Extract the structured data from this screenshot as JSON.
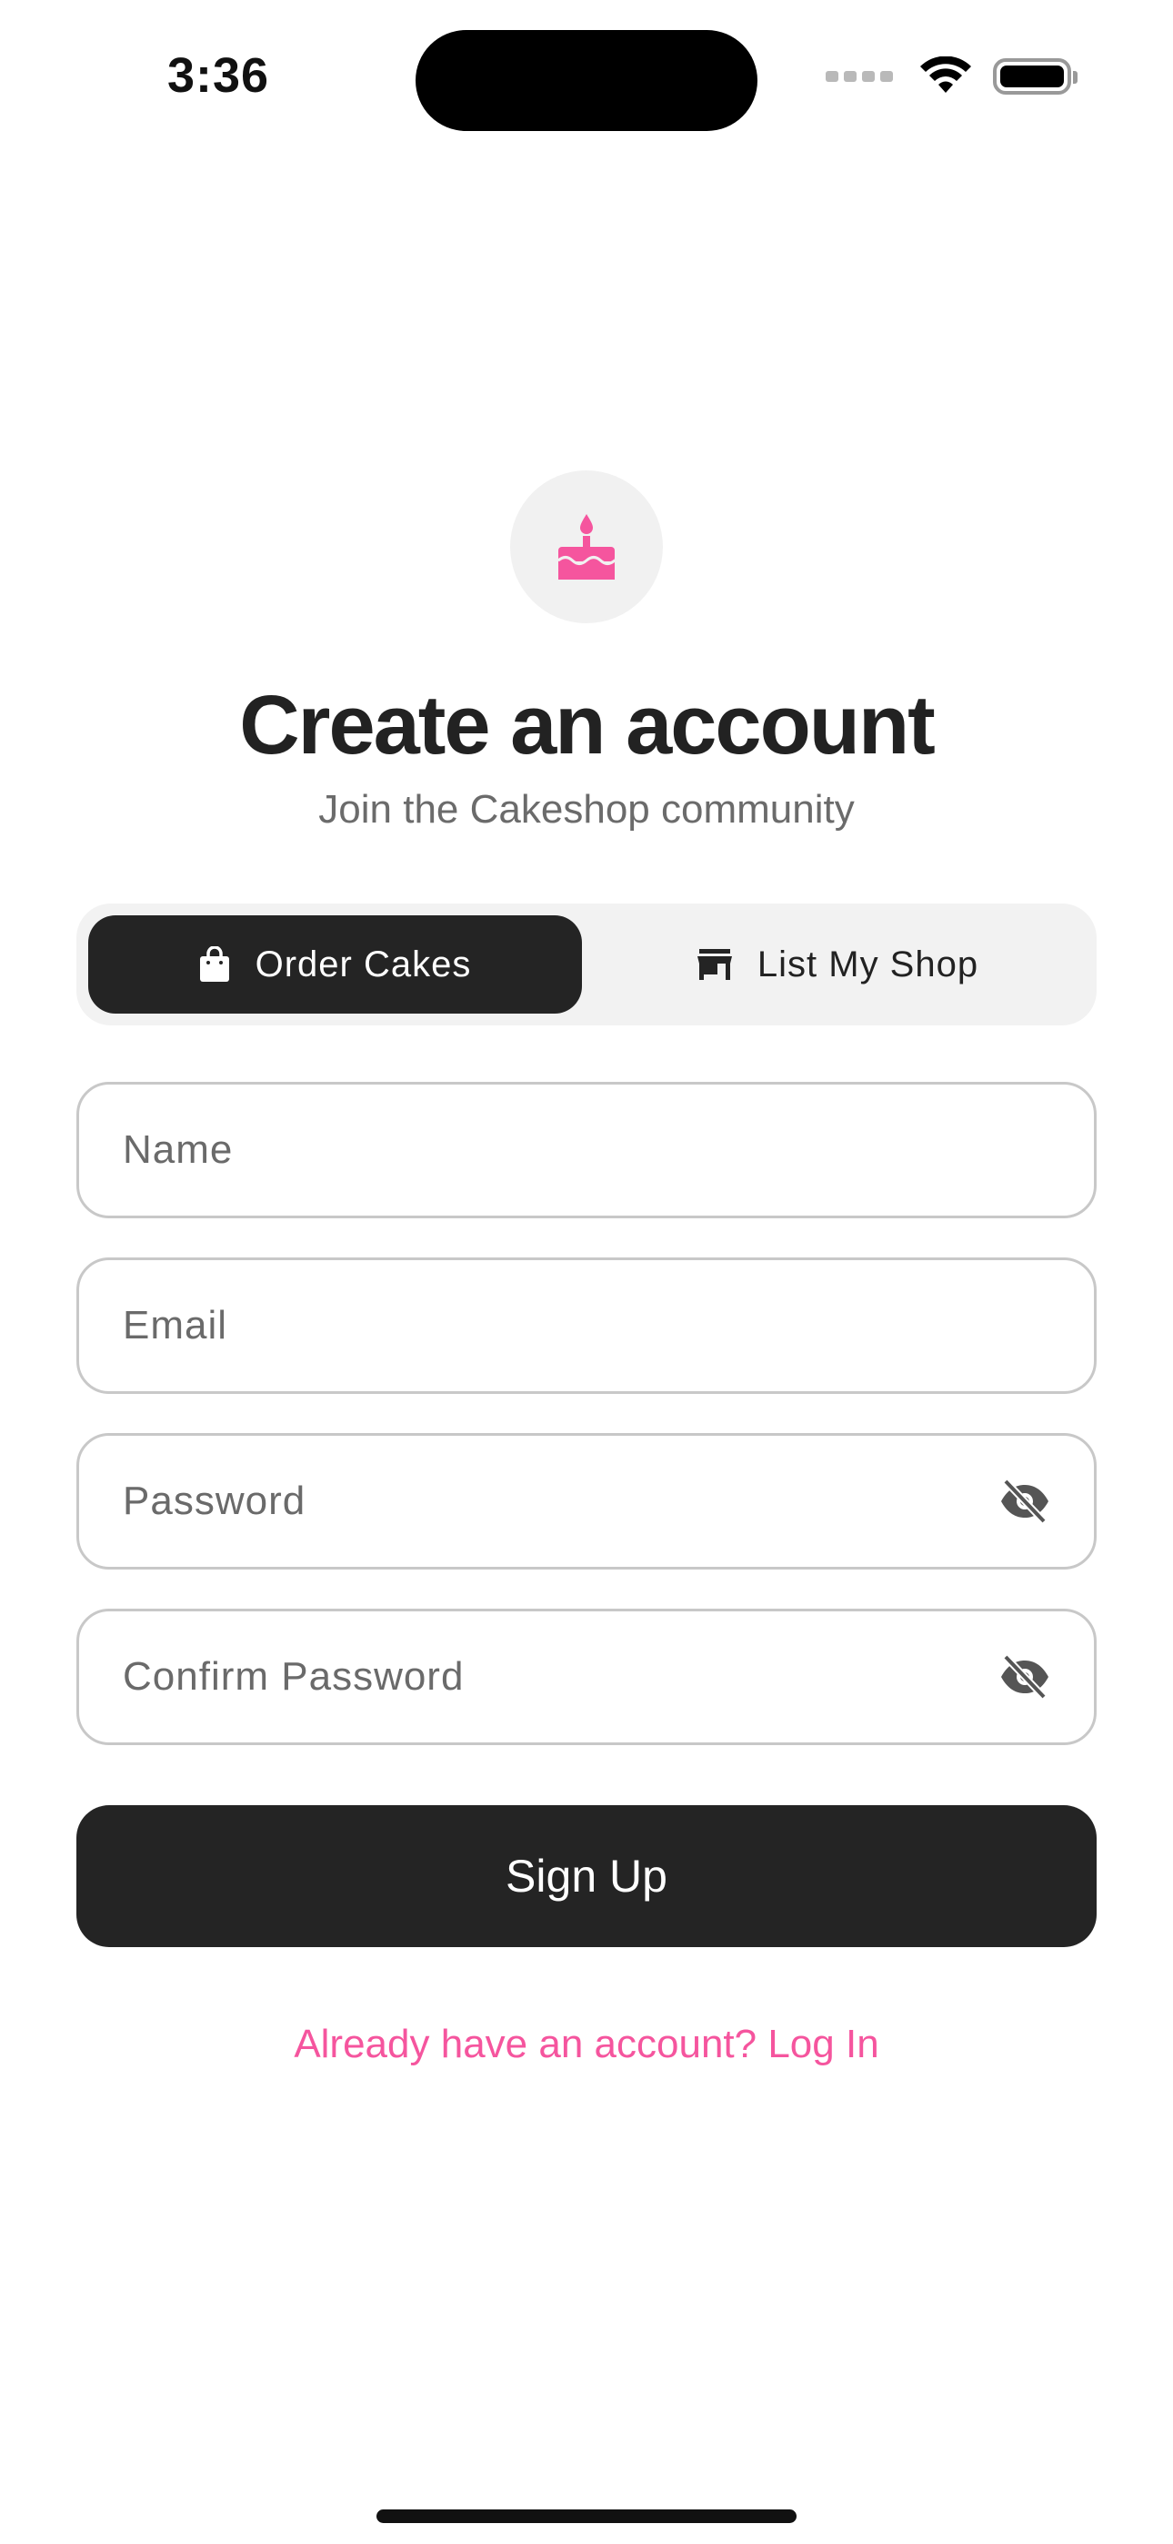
{
  "status_bar": {
    "time": "3:36"
  },
  "logo": {
    "icon": "cake-icon",
    "color": "#F5559E",
    "background": "#F1F1F1"
  },
  "header": {
    "title": "Create an account",
    "subtitle": "Join the Cakeshop community"
  },
  "role_toggle": {
    "options": [
      {
        "label": "Order Cakes",
        "icon": "shopping-bag-icon",
        "selected": true
      },
      {
        "label": "List My Shop",
        "icon": "storefront-icon",
        "selected": false
      }
    ]
  },
  "form": {
    "name": {
      "placeholder": "Name",
      "value": ""
    },
    "email": {
      "placeholder": "Email",
      "value": ""
    },
    "password": {
      "placeholder": "Password",
      "value": "",
      "icon": "eye-off-icon"
    },
    "confirm_password": {
      "placeholder": "Confirm Password",
      "value": "",
      "icon": "eye-off-icon"
    }
  },
  "actions": {
    "signup_label": "Sign Up",
    "login_link": "Already have an account? Log In"
  },
  "colors": {
    "accent": "#F5559E",
    "primary_dark": "#242424"
  }
}
